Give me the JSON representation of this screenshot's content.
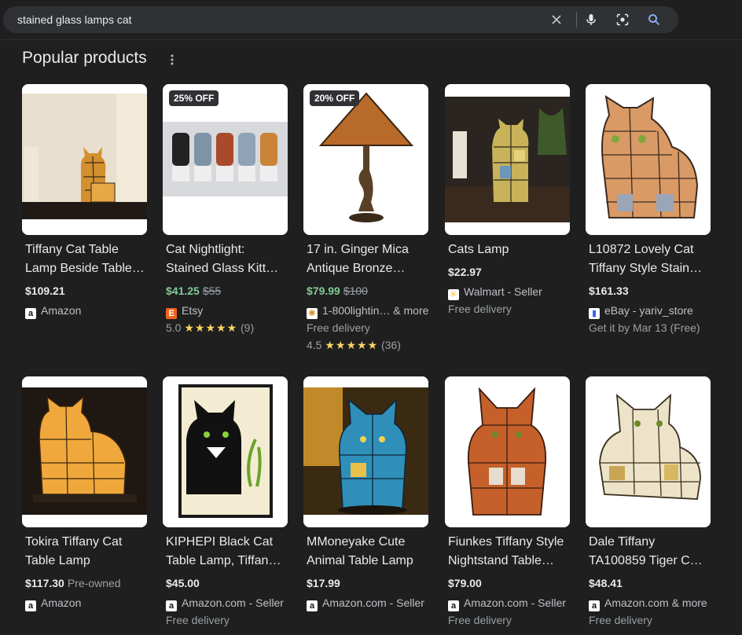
{
  "search": {
    "query": "stained glass lamps cat",
    "icons": [
      "close-icon",
      "mic-icon",
      "lens-icon",
      "search-icon"
    ]
  },
  "section": {
    "title": "Popular products"
  },
  "products": [
    {
      "title_line1": "Tiffany Cat Table",
      "title_line2": "Lamp Beside Table…",
      "price": "$109.21",
      "seller": "Amazon",
      "seller_icon": "a"
    },
    {
      "badge": "25% OFF",
      "title_line1": "Cat Nightlight:",
      "title_line2": "Stained Glass Kitte…",
      "price": "$41.25",
      "old_price": "$55",
      "seller": "Etsy",
      "seller_icon": "E",
      "rating": "5.0",
      "stars": "★★★★★",
      "reviews": "(9)"
    },
    {
      "badge": "20% OFF",
      "title_line1": "17 in. Ginger Mica",
      "title_line2": "Antique Bronze…",
      "price": "$79.99",
      "old_price": "$100",
      "seller": "1-800lightin… & more",
      "seller_icon": "✺",
      "delivery": "Free delivery",
      "rating": "4.5",
      "stars": "★★★★★",
      "reviews": "(36)"
    },
    {
      "title_line1": "Cats Lamp",
      "price": "$22.97",
      "seller": "Walmart - Seller",
      "seller_icon": "✳",
      "delivery": "Free delivery"
    },
    {
      "title_line1": "L10872 Lovely Cat",
      "title_line2": "Tiffany Style Stain…",
      "price": "$161.33",
      "seller": "eBay - yariv_store",
      "seller_icon": "▮",
      "delivery": "Get it by Mar 13 (Free)"
    },
    {
      "title_line1": "Tokira Tiffany Cat",
      "title_line2": "Table Lamp",
      "price": "$117.30",
      "condition": "Pre-owned",
      "seller": "Amazon",
      "seller_icon": "a"
    },
    {
      "title_line1": "KIPHEPI Black Cat",
      "title_line2": "Table Lamp, Tiffan…",
      "price": "$45.00",
      "seller": "Amazon.com - Seller",
      "seller_icon": "a",
      "delivery": "Free delivery"
    },
    {
      "title_line1": "MMoneyake Cute",
      "title_line2": "Animal Table Lamp",
      "price": "$17.99",
      "seller": "Amazon.com - Seller",
      "seller_icon": "a"
    },
    {
      "title_line1": "Fiunkes Tiffany Style",
      "title_line2": "Nightstand Table…",
      "price": "$79.00",
      "seller": "Amazon.com - Seller",
      "seller_icon": "a",
      "delivery": "Free delivery"
    },
    {
      "title_line1": "Dale Tiffany",
      "title_line2": "TA100859 Tiger Ca…",
      "price": "$48.41",
      "seller": "Amazon.com & more",
      "seller_icon": "a",
      "delivery": "Free delivery"
    }
  ]
}
